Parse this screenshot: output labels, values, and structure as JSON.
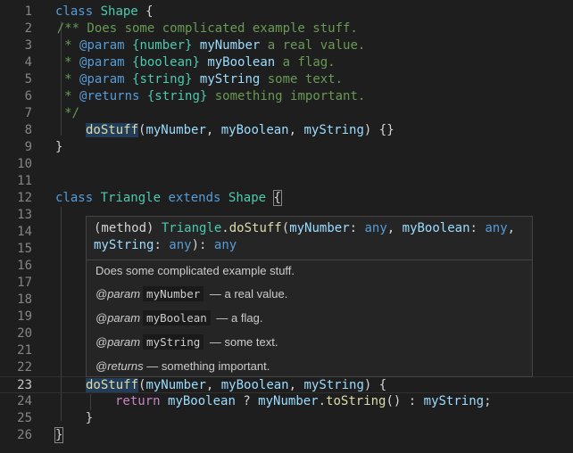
{
  "gutter_numbers": [
    "1",
    "2",
    "3",
    "4",
    "5",
    "6",
    "7",
    "8",
    "9",
    "10",
    "11",
    "12",
    "13",
    "14",
    "15",
    "16",
    "17",
    "18",
    "19",
    "20",
    "21",
    "22",
    "23",
    "24",
    "25",
    "26"
  ],
  "code": {
    "l1": {
      "kw": "class",
      "cls": "Shape",
      "rest": " {"
    },
    "l2": "    /** Does some complicated example stuff.",
    "l3": {
      "pre": "     * ",
      "tag": "@param",
      "type": " {number} ",
      "name": "myNumber",
      "desc": " a real value."
    },
    "l4": {
      "pre": "     * ",
      "tag": "@param",
      "type": " {boolean} ",
      "name": "myBoolean",
      "desc": " a flag."
    },
    "l5": {
      "pre": "     * ",
      "tag": "@param",
      "type": " {string} ",
      "name": "myString",
      "desc": " some text."
    },
    "l6": {
      "pre": "     * ",
      "tag": "@returns",
      "type": " {string}",
      "desc": " something important."
    },
    "l7": "     */",
    "l8": {
      "fn": "doStuff",
      "a": "myNumber",
      "b": "myBoolean",
      "c": "myString",
      "rest": ") {}"
    },
    "l9": "}",
    "l12": {
      "kw": "class",
      "cls": "Triangle",
      "kw2": "extends",
      "cls2": "Shape",
      "brace": "{"
    },
    "l23": {
      "fn": "doStuff",
      "a": "myNumber",
      "b": "myBoolean",
      "c": "myString",
      "rest": ") {"
    },
    "l24": {
      "ret": "return",
      "a": "myBoolean",
      "op1": " ? ",
      "b": "myNumber",
      "fn": "toString",
      "op2": "() : ",
      "c": "myString",
      "end": ";"
    },
    "l25": "    }",
    "l26": "}"
  },
  "hover": {
    "sig1": {
      "kind": "(method) ",
      "cls": "Triangle",
      "fn": "doStuff",
      "p1": "myNumber",
      "t1": "any",
      "p2": "myBoolean",
      "t2": "any"
    },
    "sig2": {
      "p3": "myString",
      "t3": "any",
      "ret": "any"
    },
    "description": "Does some complicated example stuff.",
    "params": [
      {
        "tag": "@param",
        "name": "myNumber",
        "desc": "— a real value."
      },
      {
        "tag": "@param",
        "name": "myBoolean",
        "desc": "— a flag."
      },
      {
        "tag": "@param",
        "name": "myString",
        "desc": "— some text."
      }
    ],
    "returns": {
      "tag": "@returns",
      "desc": "— something important."
    }
  }
}
